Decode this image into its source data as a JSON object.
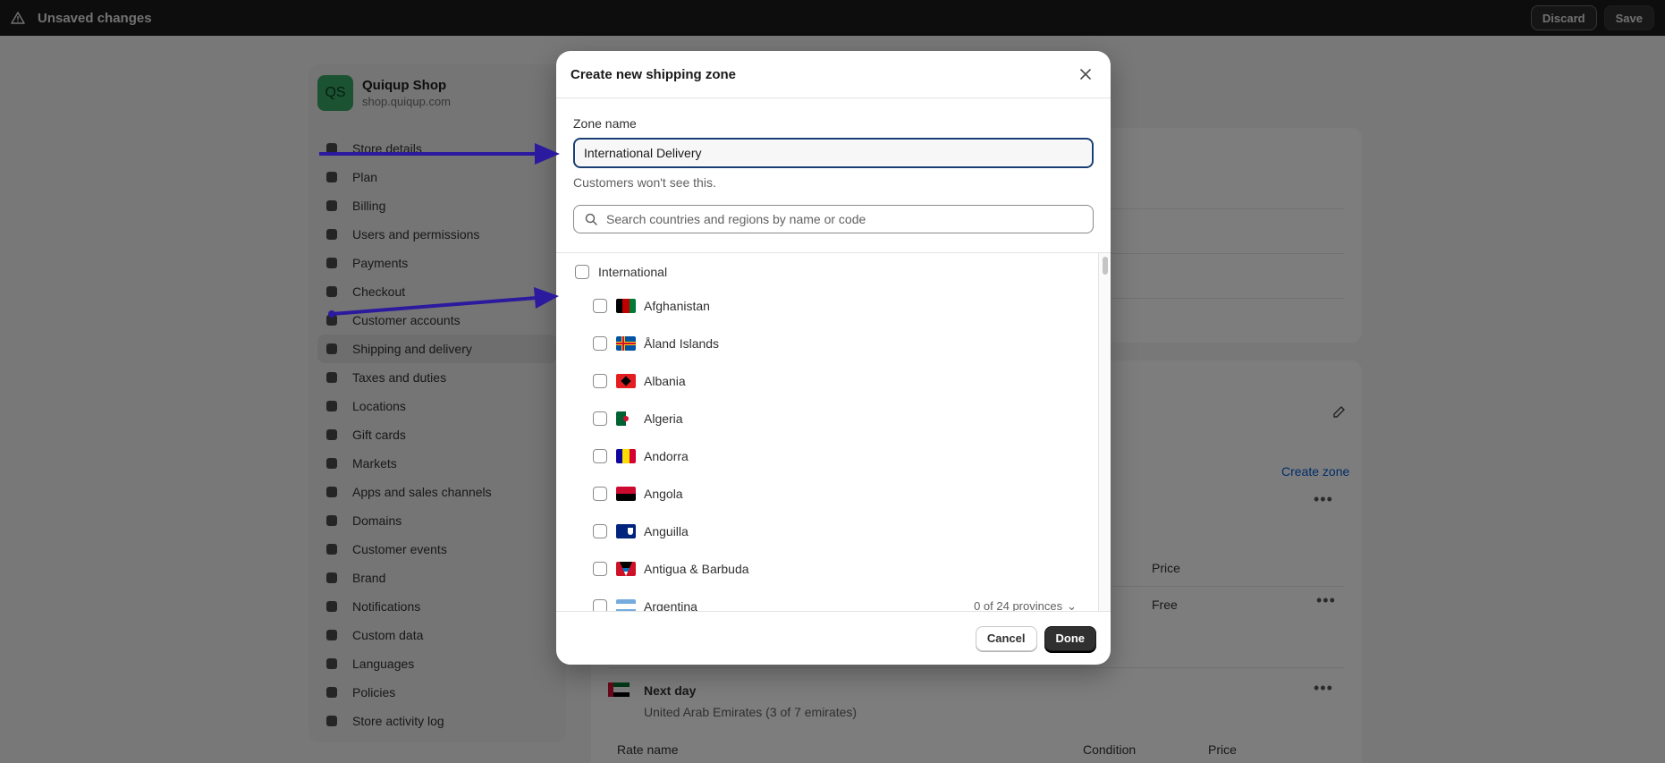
{
  "topbar": {
    "title": "Unsaved changes",
    "discard_label": "Discard",
    "save_label": "Save"
  },
  "shop": {
    "initials": "QS",
    "name": "Quiqup Shop",
    "url": "shop.quiqup.com"
  },
  "sidebar": {
    "items": [
      {
        "label": "Store details",
        "icon": "store-icon"
      },
      {
        "label": "Plan",
        "icon": "plan-icon"
      },
      {
        "label": "Billing",
        "icon": "billing-icon"
      },
      {
        "label": "Users and permissions",
        "icon": "users-icon"
      },
      {
        "label": "Payments",
        "icon": "payments-icon"
      },
      {
        "label": "Checkout",
        "icon": "cart-icon"
      },
      {
        "label": "Customer accounts",
        "icon": "person-icon"
      },
      {
        "label": "Shipping and delivery",
        "icon": "truck-icon"
      },
      {
        "label": "Taxes and duties",
        "icon": "tax-icon"
      },
      {
        "label": "Locations",
        "icon": "location-icon"
      },
      {
        "label": "Gift cards",
        "icon": "gift-icon"
      },
      {
        "label": "Markets",
        "icon": "globe-icon"
      },
      {
        "label": "Apps and sales channels",
        "icon": "apps-icon"
      },
      {
        "label": "Domains",
        "icon": "domain-icon"
      },
      {
        "label": "Customer events",
        "icon": "events-icon"
      },
      {
        "label": "Brand",
        "icon": "brand-icon"
      },
      {
        "label": "Notifications",
        "icon": "bell-icon"
      },
      {
        "label": "Custom data",
        "icon": "data-icon"
      },
      {
        "label": "Languages",
        "icon": "language-icon"
      },
      {
        "label": "Policies",
        "icon": "policy-icon"
      },
      {
        "label": "Store activity log",
        "icon": "list-icon"
      }
    ],
    "active_index": 7
  },
  "background": {
    "create_zone_label": "Create zone",
    "price_header_1": "Price",
    "free_label": "Free",
    "rate_name": "Next day",
    "rate_region": "United Arab Emirates (3 of 7 emirates)",
    "rate_name_header": "Rate name",
    "condition_header": "Condition",
    "price_header_2": "Price"
  },
  "modal": {
    "title": "Create new shipping zone",
    "zone_name_label": "Zone name",
    "zone_name_value": "International Delivery",
    "help_text": "Customers won't see this.",
    "search_placeholder": "Search countries and regions by name or code",
    "group_label": "International",
    "countries": [
      {
        "name": "Afghanistan",
        "flag": "afghanistan-flag-icon"
      },
      {
        "name": "Åland Islands",
        "flag": "aland-flag-icon"
      },
      {
        "name": "Albania",
        "flag": "albania-flag-icon"
      },
      {
        "name": "Algeria",
        "flag": "algeria-flag-icon"
      },
      {
        "name": "Andorra",
        "flag": "andorra-flag-icon"
      },
      {
        "name": "Angola",
        "flag": "angola-flag-icon"
      },
      {
        "name": "Anguilla",
        "flag": "anguilla-flag-icon"
      },
      {
        "name": "Antigua & Barbuda",
        "flag": "antigua-flag-icon"
      },
      {
        "name": "Argentina",
        "flag": "argentina-flag-icon",
        "provinces": "0 of 24 provinces"
      }
    ],
    "cancel_label": "Cancel",
    "done_label": "Done"
  },
  "colors": {
    "overlay": "#00000080",
    "annotation_arrow": "#2b1a9e",
    "focus_ring": "#1a3e73"
  }
}
